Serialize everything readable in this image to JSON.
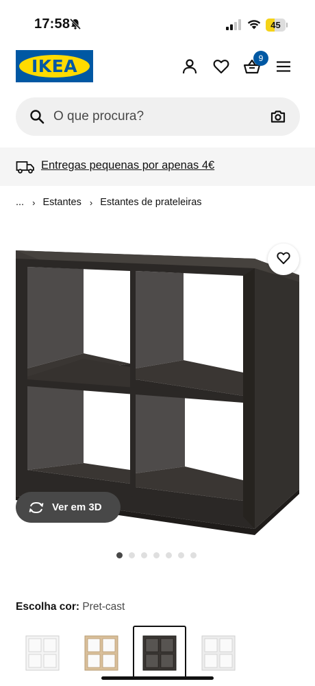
{
  "status_bar": {
    "time": "17:58",
    "battery_level": "45",
    "battery_fraction": 0.45,
    "battery_color": "#f5d318"
  },
  "header": {
    "logo_text": "IKEA",
    "icons": [
      "user-icon",
      "heart-icon",
      "basket-icon",
      "menu-icon"
    ],
    "basket_count": "9",
    "brand_blue": "#0058a3",
    "brand_yellow": "#ffdb00"
  },
  "search": {
    "placeholder": "O que procura?",
    "value": ""
  },
  "banner": {
    "text": "Entregas pequenas por apenas 4€"
  },
  "breadcrumb": {
    "items": [
      "...",
      "Estantes",
      "Estantes de prateleiras"
    ]
  },
  "product": {
    "view3d_label": "Ver em 3D",
    "gallery_dots": 7,
    "active_dot": 1
  },
  "color_choice": {
    "label": "Escolha cor:",
    "value": "Pret-cast",
    "swatches": [
      {
        "name": "white",
        "color": "#f4f4f4",
        "selected": false
      },
      {
        "name": "oak",
        "color": "#d9bf9a",
        "selected": false
      },
      {
        "name": "black-brown",
        "color": "#3a3633",
        "selected": true
      },
      {
        "name": "white-stained-oak",
        "color": "#ececec",
        "selected": false
      }
    ]
  }
}
